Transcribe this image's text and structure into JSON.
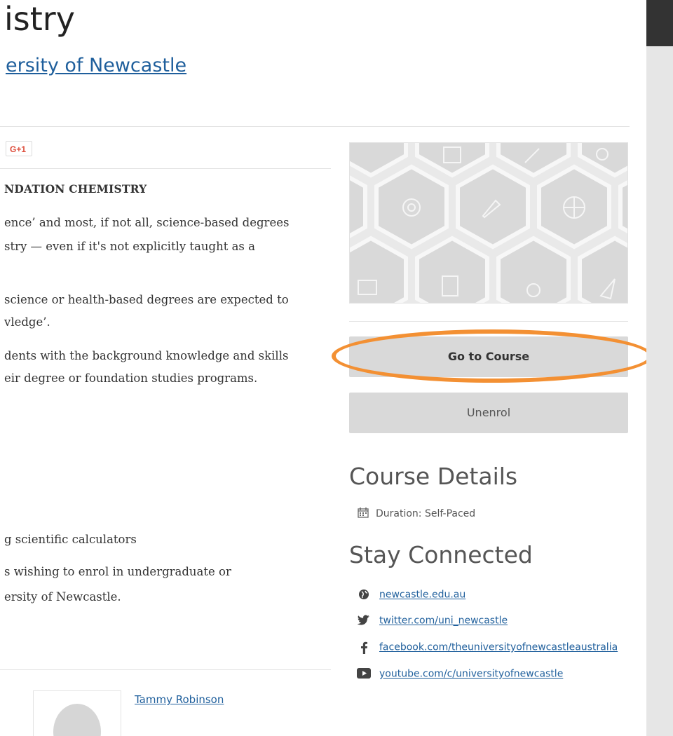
{
  "course": {
    "title_partial": "istry",
    "org_partial": "ersity of Newcastle",
    "gplus_label": "G+1",
    "section_title_partial": "NDATION CHEMISTRY"
  },
  "description": {
    "paragraphs": [
      [
        "ence’ and most, if not all, science-based degrees",
        "stry — even if it's not explicitly taught as a"
      ],
      [
        "science or health-based degrees are expected to",
        "vledge’."
      ],
      [
        "dents with the background knowledge and skills",
        "eir degree or foundation studies programs."
      ],
      [
        "g scientific calculators"
      ],
      [
        "s wishing to enrol in undergraduate or",
        "ersity of Newcastle."
      ]
    ]
  },
  "sidebar": {
    "go_to_course_label": "Go to Course",
    "unenrol_label": "Unenrol",
    "course_details_heading": "Course Details",
    "duration_text": "Duration: Self-Paced",
    "stay_connected_heading": "Stay Connected",
    "links": [
      {
        "icon": "globe-icon",
        "text": "newcastle.edu.au"
      },
      {
        "icon": "twitter-icon",
        "text": "twitter.com/uni_newcastle"
      },
      {
        "icon": "facebook-icon",
        "text": "facebook.com/theuniversityofnewcastleaustralia"
      },
      {
        "icon": "youtube-icon",
        "text": "youtube.com/c/universityofnewcastle"
      }
    ]
  },
  "instructor": {
    "name": "Tammy Robinson"
  },
  "colors": {
    "link": "#1f5f9c",
    "button_bg": "#d9d9d9",
    "highlight": "#f39033",
    "scroll_thumb": "#333333"
  }
}
